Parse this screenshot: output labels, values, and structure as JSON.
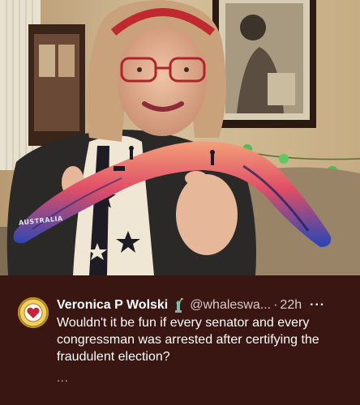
{
  "photo": {
    "boomerang_label": "AUSTRALIA",
    "subject": "photo"
  },
  "post": {
    "display_name": "Veronica P Wolski",
    "badge_icon": "statue-of-liberty-emoji",
    "handle": "@whaleswa...",
    "separator": "·",
    "time": "22h",
    "more_label": "···",
    "text": "Wouldn't it be fun if every senator and every congressman was arrested after certifying the fraudulent election?",
    "truncation": "..."
  },
  "colors": {
    "post_background": "#3a1613",
    "name": "#ffffff",
    "secondary": "#d9cbc8",
    "avatar": "#e9c23d"
  }
}
